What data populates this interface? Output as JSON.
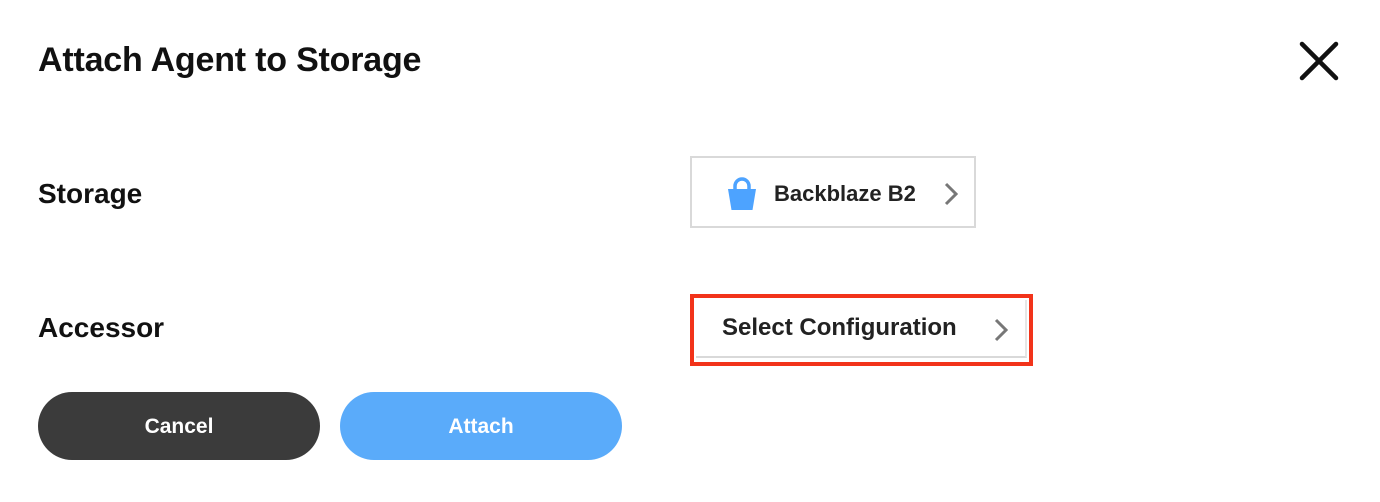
{
  "dialog": {
    "title": "Attach Agent to Storage",
    "close_icon": "close-icon"
  },
  "storage": {
    "label": "Storage",
    "value": "Backblaze B2",
    "icon": "bucket-icon",
    "icon_color": "#4da3ff"
  },
  "accessor": {
    "label": "Accessor",
    "value": "Select Configuration",
    "highlight_color": "#f2331a"
  },
  "actions": {
    "cancel_label": "Cancel",
    "attach_label": "Attach",
    "cancel_color": "#3b3b3b",
    "attach_color": "#5aabfa"
  }
}
